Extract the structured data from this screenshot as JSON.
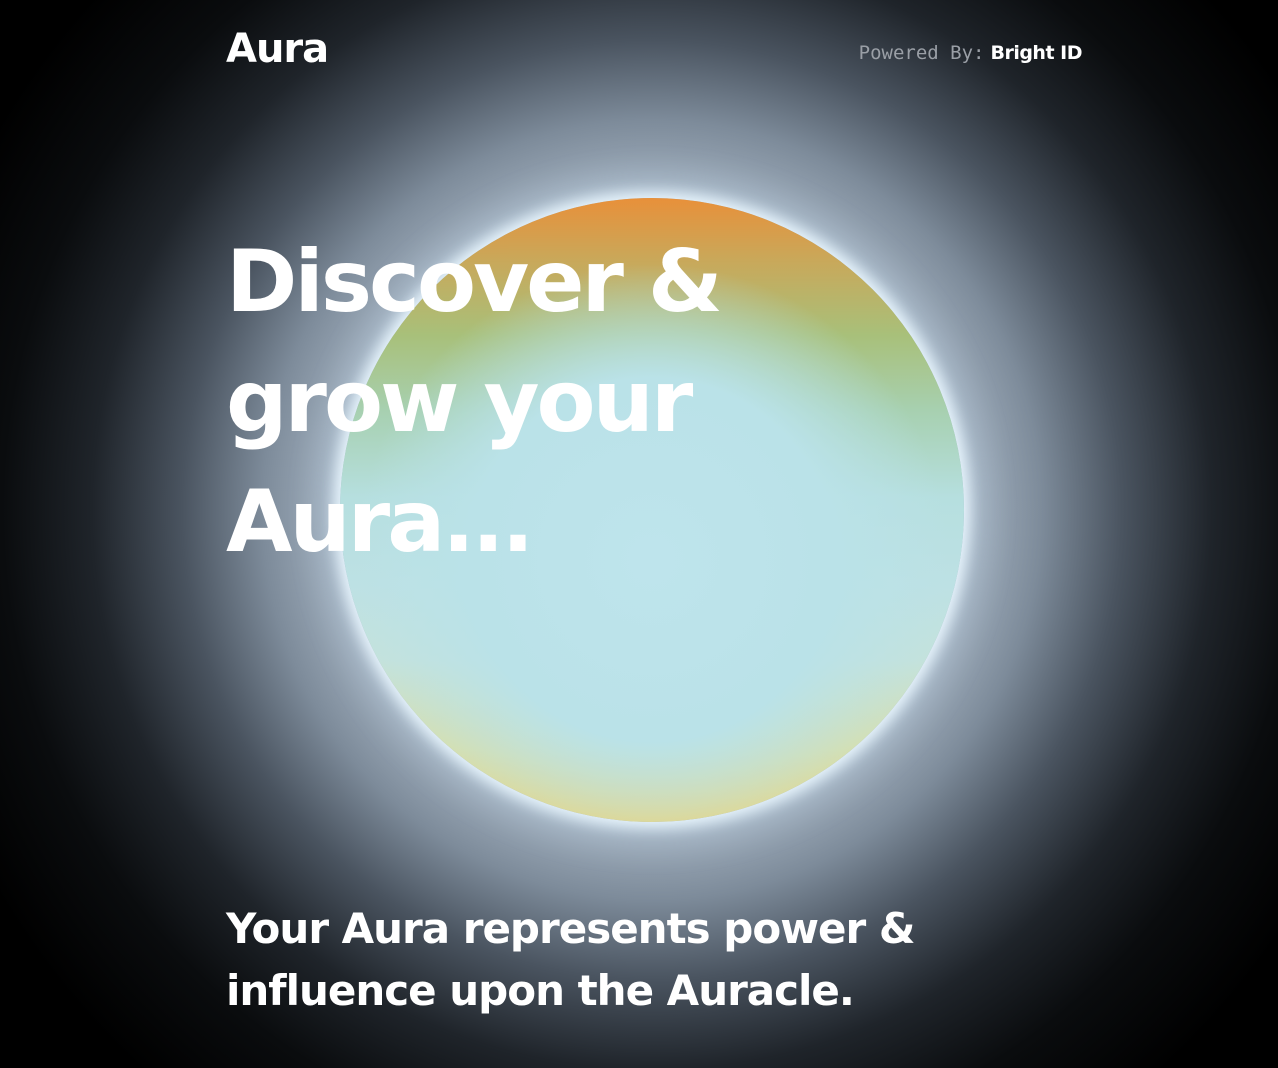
{
  "header": {
    "logo": "Aura",
    "powered_by_label": "Powered By:",
    "powered_by_brand": "Bright ID"
  },
  "hero": {
    "headline": "Discover & grow your Aura...",
    "tagline": "Your Aura represents power & influence upon the Auracle."
  },
  "colors": {
    "background": "#000000",
    "text": "#ffffff",
    "muted_text": "#9a9fa6",
    "orb_top": "#e8903a",
    "orb_middle": "#bde1e4",
    "orb_bottom": "#ead47a"
  }
}
